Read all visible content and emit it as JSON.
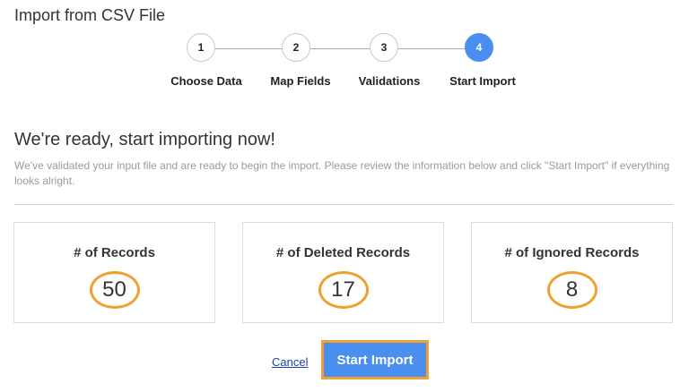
{
  "page": {
    "title": "Import from CSV File"
  },
  "steps": [
    {
      "number": "1",
      "label": "Choose Data",
      "active": false
    },
    {
      "number": "2",
      "label": "Map Fields",
      "active": false
    },
    {
      "number": "3",
      "label": "Validations",
      "active": false
    },
    {
      "number": "4",
      "label": "Start Import",
      "active": true
    }
  ],
  "main": {
    "heading": "We're ready, start importing now!",
    "description": "We've validated your input file and are ready to begin the import. Please review the information below and click \"Start Import\" if everything looks alright."
  },
  "stats": [
    {
      "label": "# of Records",
      "value": "50"
    },
    {
      "label": "# of Deleted Records",
      "value": "17"
    },
    {
      "label": "# of Ignored Records",
      "value": "8"
    }
  ],
  "actions": {
    "cancel_label": "Cancel",
    "start_label": "Start Import"
  },
  "colors": {
    "accent": "#4a8ef0",
    "highlight": "#f0a030",
    "link": "#1a3fb0"
  }
}
